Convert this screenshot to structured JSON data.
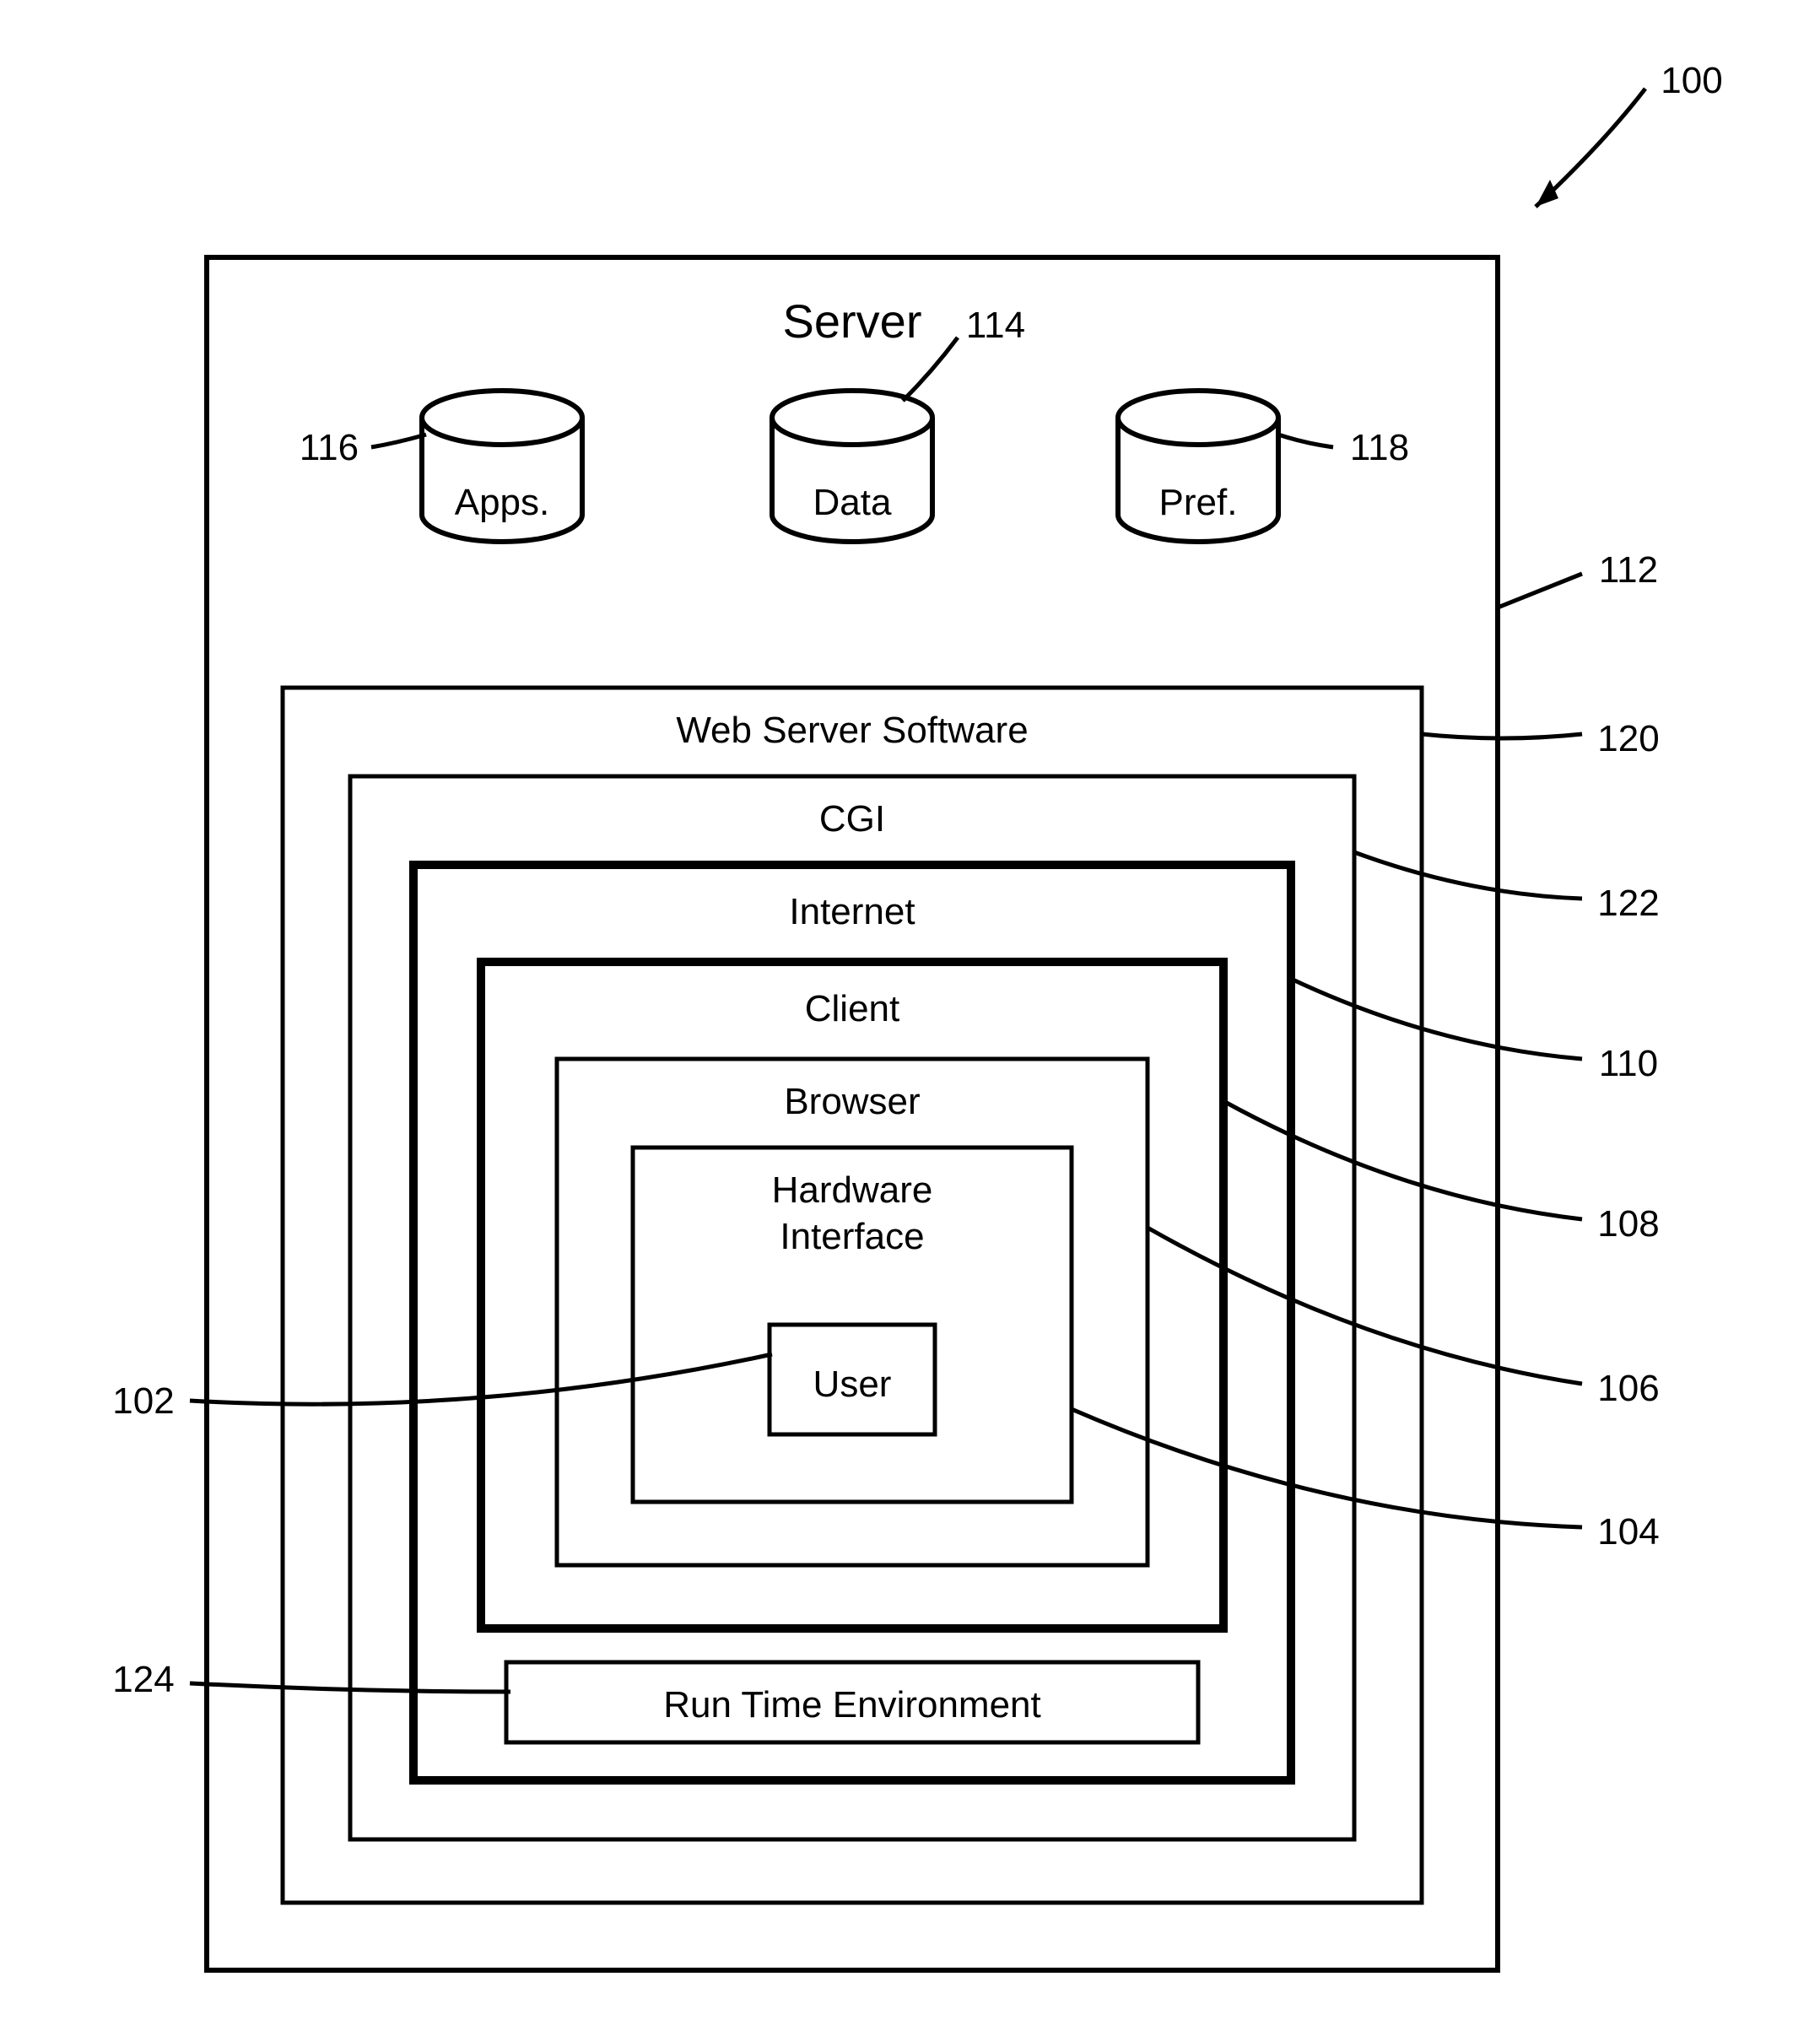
{
  "title": "Server",
  "cylinders": {
    "apps": "Apps.",
    "data": "Data",
    "pref": "Pref."
  },
  "boxes": {
    "wss": "Web Server Software",
    "cgi": "CGI",
    "internet": "Internet",
    "client": "Client",
    "browser": "Browser",
    "hwif_line1": "Hardware",
    "hwif_line2": "Interface",
    "user": "User",
    "rte": "Run Time Environment"
  },
  "refs": {
    "r100": "100",
    "r112": "112",
    "r114": "114",
    "r116": "116",
    "r118": "118",
    "r120": "120",
    "r122": "122",
    "r110": "110",
    "r108": "108",
    "r106": "106",
    "r102": "102",
    "r104": "104",
    "r124": "124"
  }
}
